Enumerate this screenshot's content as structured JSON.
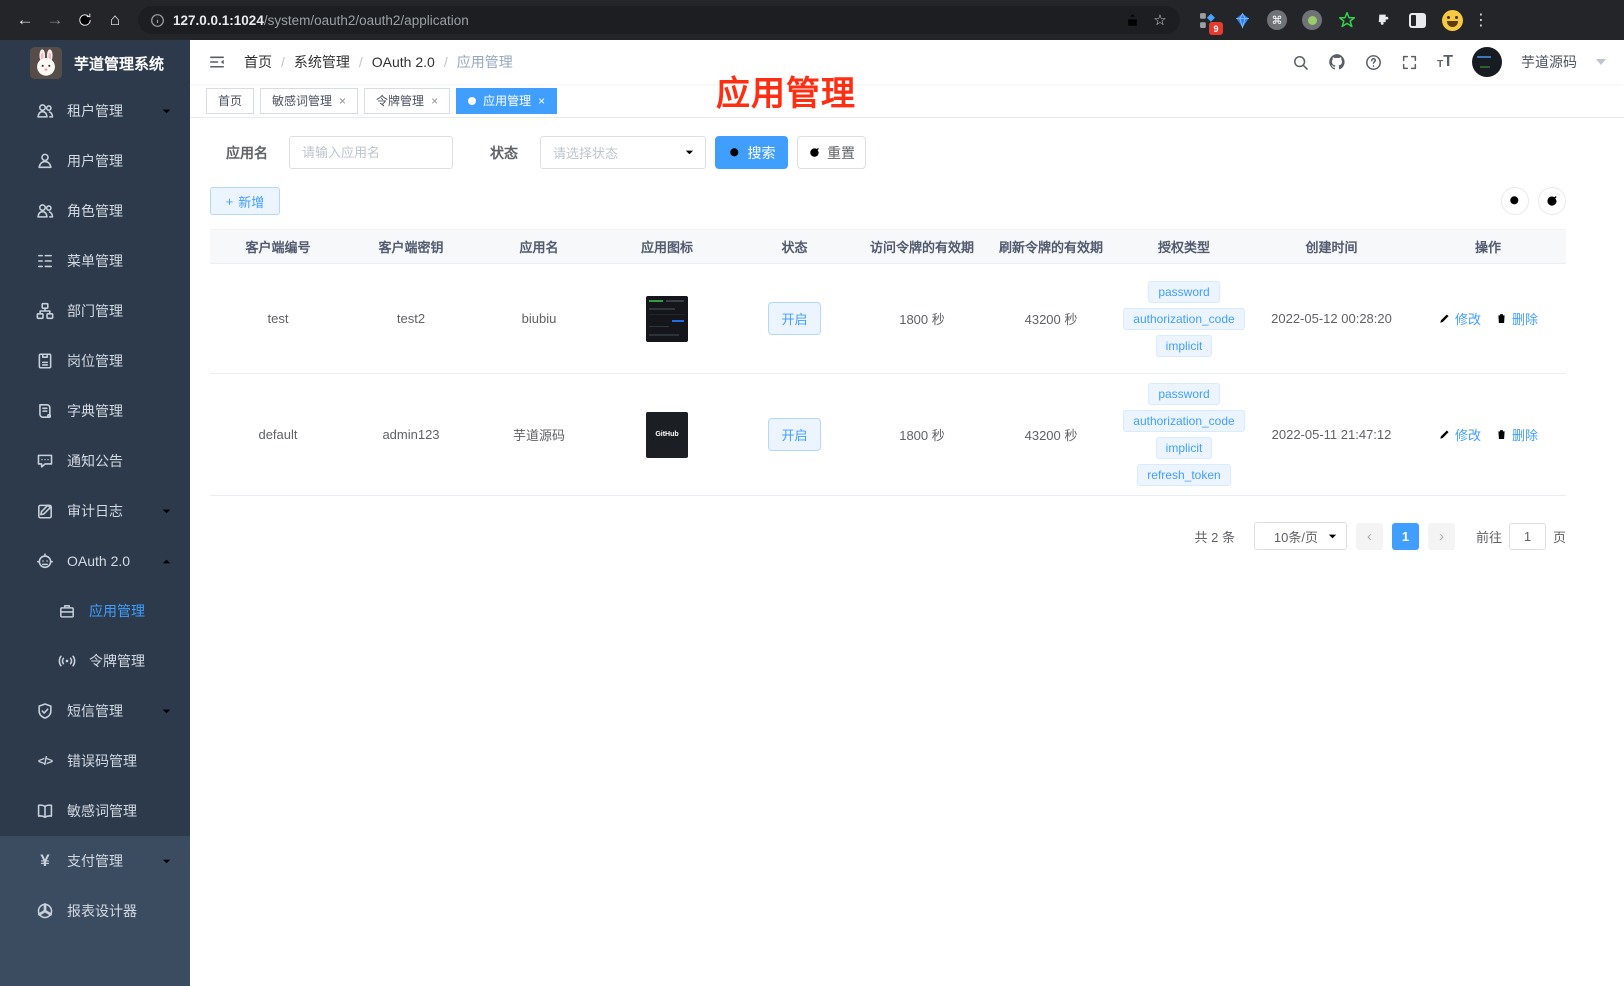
{
  "colors": {
    "accent": "#409eff",
    "annotation_red": "#ff2d12",
    "sidebar_bg": "#2d3a4b",
    "tag_bg": "#ecf5ff"
  },
  "browser": {
    "url_host": "127.0.0.1:1024",
    "url_path": "/system/oauth2/oauth2/application",
    "ext_badge": "9"
  },
  "sidebar": {
    "app_title": "芋道管理系统",
    "items": [
      {
        "label": "租户管理"
      },
      {
        "label": "用户管理"
      },
      {
        "label": "角色管理"
      },
      {
        "label": "菜单管理"
      },
      {
        "label": "部门管理"
      },
      {
        "label": "岗位管理"
      },
      {
        "label": "字典管理"
      },
      {
        "label": "通知公告"
      },
      {
        "label": "审计日志"
      },
      {
        "label": "OAuth 2.0"
      },
      {
        "label": "应用管理"
      },
      {
        "label": "令牌管理"
      },
      {
        "label": "短信管理"
      },
      {
        "label": "错误码管理"
      },
      {
        "label": "敏感词管理"
      },
      {
        "label": "支付管理"
      },
      {
        "label": "报表设计器"
      }
    ]
  },
  "header": {
    "breadcrumb": [
      "首页",
      "系统管理",
      "OAuth 2.0",
      "应用管理"
    ],
    "breadcrumb_sep": "/",
    "user_name": "芋道源码"
  },
  "tabs": [
    {
      "label": "首页"
    },
    {
      "label": "敏感词管理"
    },
    {
      "label": "令牌管理"
    },
    {
      "label": "应用管理"
    }
  ],
  "annotation": {
    "text": "应用管理"
  },
  "filter": {
    "name_label": "应用名",
    "name_placeholder": "请输入应用名",
    "status_label": "状态",
    "status_placeholder": "请选择状态",
    "search_label": "搜索",
    "reset_label": "重置",
    "add_label": "新增"
  },
  "table": {
    "headers": [
      "客户端编号",
      "客户端密钥",
      "应用名",
      "应用图标",
      "状态",
      "访问令牌的有效期",
      "刷新令牌的有效期",
      "授权类型",
      "创建时间",
      "操作"
    ],
    "edit_label": "修改",
    "delete_label": "删除",
    "rows": [
      {
        "client_id": "test",
        "client_secret": "test2",
        "app_name": "biubiu",
        "status": "开启",
        "access_token_validity": "1800 秒",
        "refresh_token_validity": "43200 秒",
        "grant_types": [
          "password",
          "authorization_code",
          "implicit"
        ],
        "created_at": "2022-05-12 00:28:20"
      },
      {
        "client_id": "default",
        "client_secret": "admin123",
        "app_name": "芋道源码",
        "status": "开启",
        "access_token_validity": "1800 秒",
        "refresh_token_validity": "43200 秒",
        "grant_types": [
          "password",
          "authorization_code",
          "implicit",
          "refresh_token"
        ],
        "created_at": "2022-05-11 21:47:12",
        "icon_text": "GitHub"
      }
    ]
  },
  "pagination": {
    "total": "共 2 条",
    "page_size": "10条/页",
    "current_page": "1",
    "goto_label": "前往",
    "goto_value": "1",
    "goto_suffix": "页"
  }
}
